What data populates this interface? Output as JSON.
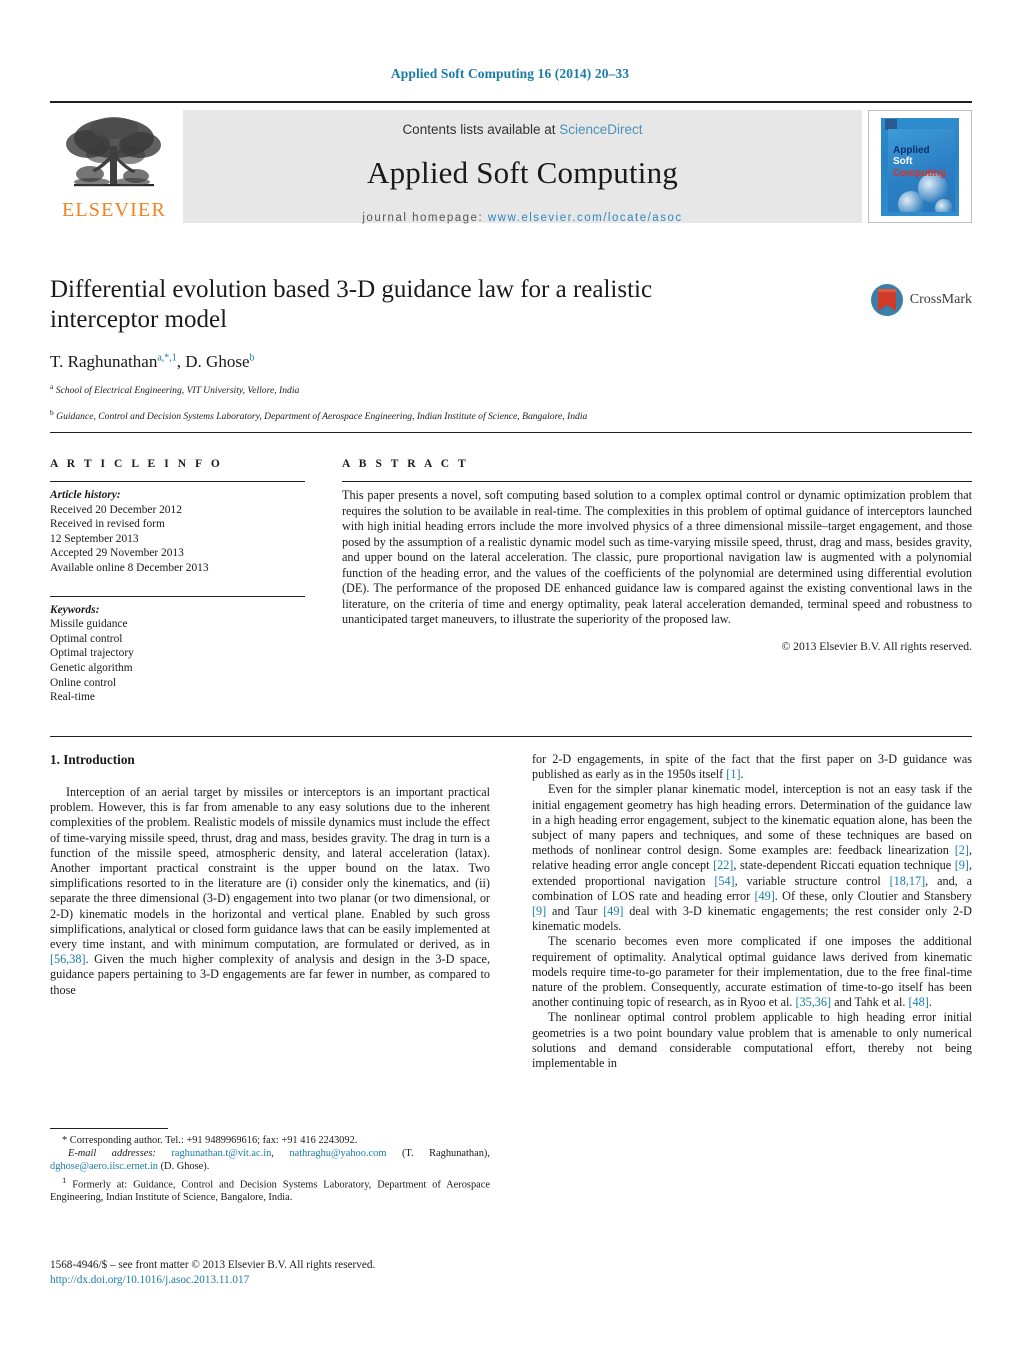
{
  "running_head": "Applied Soft Computing 16 (2014) 20–33",
  "masthead": {
    "contents_prefix": "Contents lists available at ",
    "sciencedirect": "ScienceDirect",
    "journal_title": "Applied Soft Computing",
    "homepage_label": "journal homepage:",
    "homepage_url": "www.elsevier.com/locate/asoc",
    "publisher": "ELSEVIER",
    "cover": {
      "line1": "Applied",
      "line2": "Soft",
      "line3": "Computing"
    },
    "colors": {
      "link_blue": "#2f87c0",
      "sciencedirect_blue": "#4a90b8",
      "elsevier_orange": "#f08222",
      "band_gray": "#e7e7e7"
    }
  },
  "article": {
    "title": "Differential evolution based 3-D guidance law for a realistic interceptor model",
    "authors_html": "T. Raghunathan<sup>a,*,1</sup>, D. Ghose<sup>b</sup>",
    "affiliation_a": "School of Electrical Engineering, VIT University, Vellore, India",
    "affiliation_b": "Guidance, Control and Decision Systems Laboratory, Department of Aerospace Engineering, Indian Institute of Science, Bangalore, India",
    "crossmark_label": "CrossMark"
  },
  "article_info": {
    "heading": "A R T I C L E   I N F O",
    "history_label": "Article history:",
    "history": [
      "Received 20 December 2012",
      "Received in revised form",
      "12 September 2013",
      "Accepted 29 November 2013",
      "Available online 8 December 2013"
    ],
    "keywords_label": "Keywords:",
    "keywords": [
      "Missile guidance",
      "Optimal control",
      "Optimal trajectory",
      "Genetic algorithm",
      "Online control",
      "Real-time"
    ]
  },
  "abstract": {
    "heading": "A B S T R A C T",
    "text": "This paper presents a novel, soft computing based solution to a complex optimal control or dynamic optimization problem that requires the solution to be available in real-time. The complexities in this problem of optimal guidance of interceptors launched with high initial heading errors include the more involved physics of a three dimensional missile–target engagement, and those posed by the assumption of a realistic dynamic model such as time-varying missile speed, thrust, drag and mass, besides gravity, and upper bound on the lateral acceleration. The classic, pure proportional navigation law is augmented with a polynomial function of the heading error, and the values of the coefficients of the polynomial are determined using differential evolution (DE). The performance of the proposed DE enhanced guidance law is compared against the existing conventional laws in the literature, on the criteria of time and energy optimality, peak lateral acceleration demanded, terminal speed and robustness to unanticipated target maneuvers, to illustrate the superiority of the proposed law.",
    "copyright": "© 2013 Elsevier B.V. All rights reserved."
  },
  "introduction": {
    "section_title": "1.  Introduction",
    "left_para_1": "Interception of an aerial target by missiles or interceptors is an important practical problem. However, this is far from amenable to any easy solutions due to the inherent complexities of the problem. Realistic models of missile dynamics must include the effect of time-varying missile speed, thrust, drag and mass, besides gravity. The drag in turn is a function of the missile speed, atmospheric density, and lateral acceleration (latax). Another important practical constraint is the upper bound on the latax. Two simplifications resorted to in the literature are (i) consider only the kinematics, and (ii) separate the three dimensional (3-D) engagement into two planar (or two dimensional, or 2-D) kinematic models in the horizontal and vertical plane. Enabled by such gross simplifications, analytical or closed form guidance laws that can be easily implemented at every time instant, and with minimum computation, are formulated or derived, as in ",
    "left_ref_1": "[56,38]",
    "left_para_1b": ". Given the much higher complexity of analysis and design in the 3-D space, guidance papers pertaining to 3-D engagements are far fewer in number, as compared to those",
    "right_para_1a": "for 2-D engagements, in spite of the fact that the first paper on 3-D guidance was published as early as in the 1950s itself ",
    "right_ref_1": "[1]",
    "right_para_1b": ".",
    "right_para_2a": "Even for the simpler planar kinematic model, interception is not an easy task if the initial engagement geometry has high heading errors. Determination of the guidance law in a high heading error engagement, subject to the kinematic equation alone, has been the subject of many papers and techniques, and some of these techniques are based on methods of nonlinear control design. Some examples are: feedback linearization ",
    "right_ref_2": "[2]",
    "right_para_2b": ", relative heading error angle concept ",
    "right_ref_3": "[22]",
    "right_para_2c": ", state-dependent Riccati equation technique ",
    "right_ref_4": "[9]",
    "right_para_2d": ", extended proportional navigation ",
    "right_ref_5": "[54]",
    "right_para_2e": ", variable structure control ",
    "right_ref_6": "[18,17]",
    "right_para_2f": ", and, a combination of LOS rate and heading error ",
    "right_ref_7": "[49]",
    "right_para_2g": ". Of these, only Cloutier and Stansbery ",
    "right_ref_8": "[9]",
    "right_para_2h": " and Taur ",
    "right_ref_9": "[49]",
    "right_para_2i": " deal with 3-D kinematic engagements; the rest consider only 2-D kinematic models.",
    "right_para_3a": "The scenario becomes even more complicated if one imposes the additional requirement of optimality. Analytical optimal guidance laws derived from kinematic models require time-to-go parameter for their implementation, due to the free final-time nature of the problem. Consequently, accurate estimation of time-to-go itself has been another continuing topic of research, as in Ryoo et al. ",
    "right_ref_10": "[35,36]",
    "right_para_3b": " and Tahk et al. ",
    "right_ref_11": "[48]",
    "right_para_3c": ".",
    "right_para_4": "The nonlinear optimal control problem applicable to high heading error initial geometries is a two point boundary value problem that is amenable to only numerical solutions and demand considerable computational effort, thereby not being implementable in"
  },
  "footnotes": {
    "corresponding": "Corresponding author. Tel.: +91 9489969616; fax: +91 416 2243092.",
    "email_label": "E-mail addresses:",
    "email_1": "raghunathan.t@vit.ac.in",
    "email_2": "nathraghu@yahoo.com",
    "email_1_owner": "(T. Raghunathan)",
    "email_3": "dghose@aero.iisc.ernet.in",
    "email_3_owner": "(D. Ghose).",
    "formerly_marker": "1",
    "formerly": "Formerly at: Guidance, Control and Decision Systems Laboratory, Department of Aerospace Engineering, Indian Institute of Science, Bangalore, India."
  },
  "frontmatter": {
    "line": "1568-4946/$ – see front matter © 2013 Elsevier B.V. All rights reserved.",
    "doi": "http://dx.doi.org/10.1016/j.asoc.2013.11.017"
  }
}
